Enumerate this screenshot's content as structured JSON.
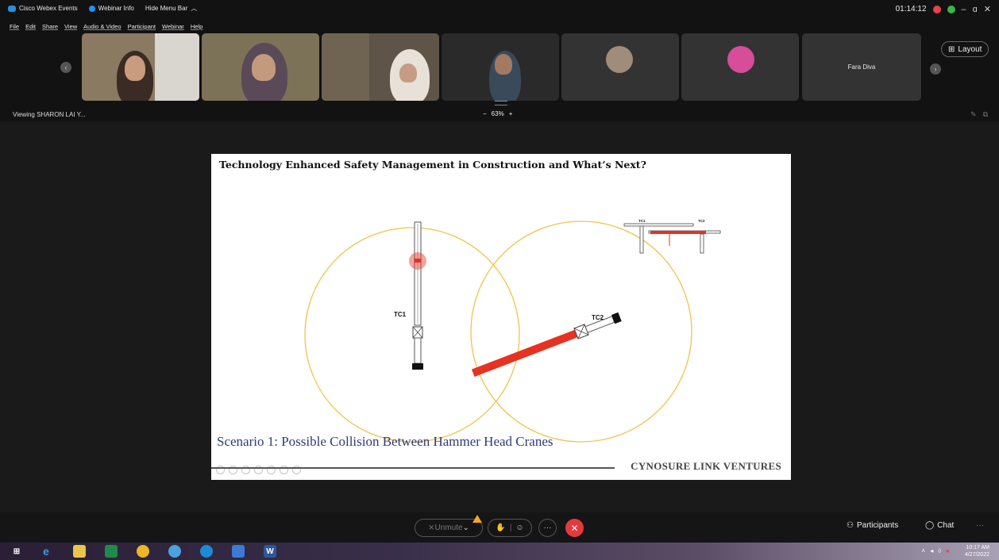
{
  "titlebar": {
    "app_name": "Cisco Webex Events",
    "webinar_info": "Webinar Info",
    "hide_menu": "Hide Menu Bar",
    "timer": "01:14:12",
    "minimize": "–",
    "restore": "ɑ",
    "close": "✕"
  },
  "menu": [
    "File",
    "Edit",
    "Share",
    "View",
    "Audio & Video",
    "Participant",
    "Webinar",
    "Help"
  ],
  "participants": {
    "fara_diva": "Fara Diva",
    "layout_label": "Layout"
  },
  "viewing_label": "Viewing SHARON LAI Y...",
  "zoom": {
    "minus": "−",
    "level": "63%",
    "plus": "+"
  },
  "slide": {
    "title": "Technology Enhanced Safety Management in Construction and What’s Next?",
    "tc1": "TC1",
    "tc2": "TC2",
    "tc1_small": "TC1",
    "tc2_small": "TC2",
    "caption": "Scenario 1: Possible Collision Between Hammer Head Cranes",
    "brand": "CYNOSURE LINK VENTURES"
  },
  "controls": {
    "unmute": "Unmute",
    "more": "···",
    "participants": "Participants",
    "chat": "Chat",
    "overflow": "···"
  },
  "tray": {
    "time": "10:17 AM",
    "date": "4/27/2022"
  },
  "colors": {
    "crane_red": "#e53222",
    "radius_circle": "#f2c24a",
    "end_call": "#e5393d",
    "record": "#e8414a"
  }
}
